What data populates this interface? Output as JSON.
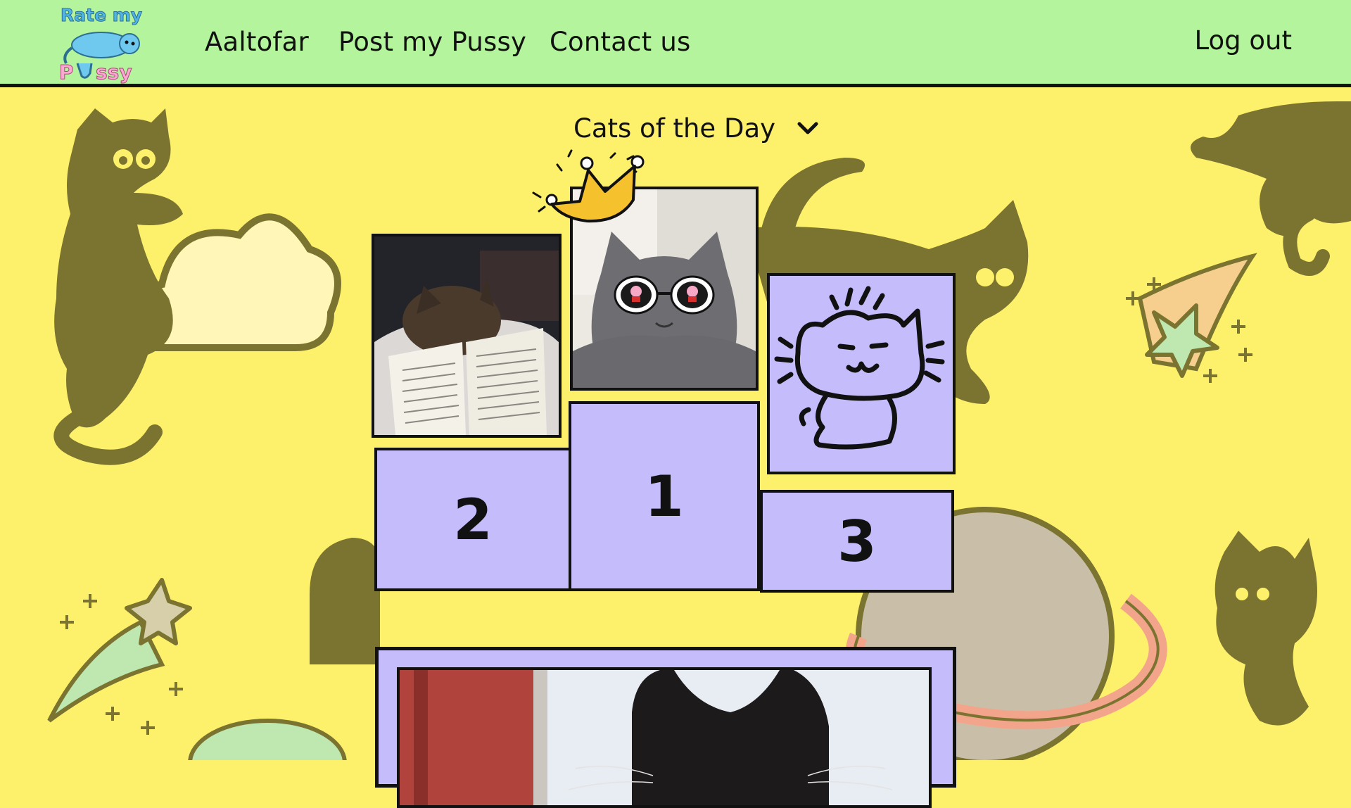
{
  "nav": {
    "logo_line1": "Rate my",
    "logo_line2_p": "P",
    "logo_line2_rest": "ssy",
    "links": [
      {
        "label": "Aaltofar"
      },
      {
        "label": "Post my Pussy"
      },
      {
        "label": "Contact us"
      }
    ],
    "logout_label": "Log out"
  },
  "filter": {
    "selected": "Cats of the Day",
    "icon": "chevron-down-icon"
  },
  "podium": {
    "places": [
      {
        "rank_label": "1",
        "photo": "grey-cat-with-peppa-sunglasses"
      },
      {
        "rank_label": "2",
        "photo": "tortoiseshell-cat-with-book"
      },
      {
        "rank_label": "3",
        "photo": "cat-doodle"
      }
    ],
    "winner_icon": "crown-icon"
  },
  "colors": {
    "header_bg": "#b3f49c",
    "page_bg": "#fdf06b",
    "podium_fill": "#c5bdfb",
    "cat_silhouette": "#7a7430",
    "outline": "#111111"
  }
}
